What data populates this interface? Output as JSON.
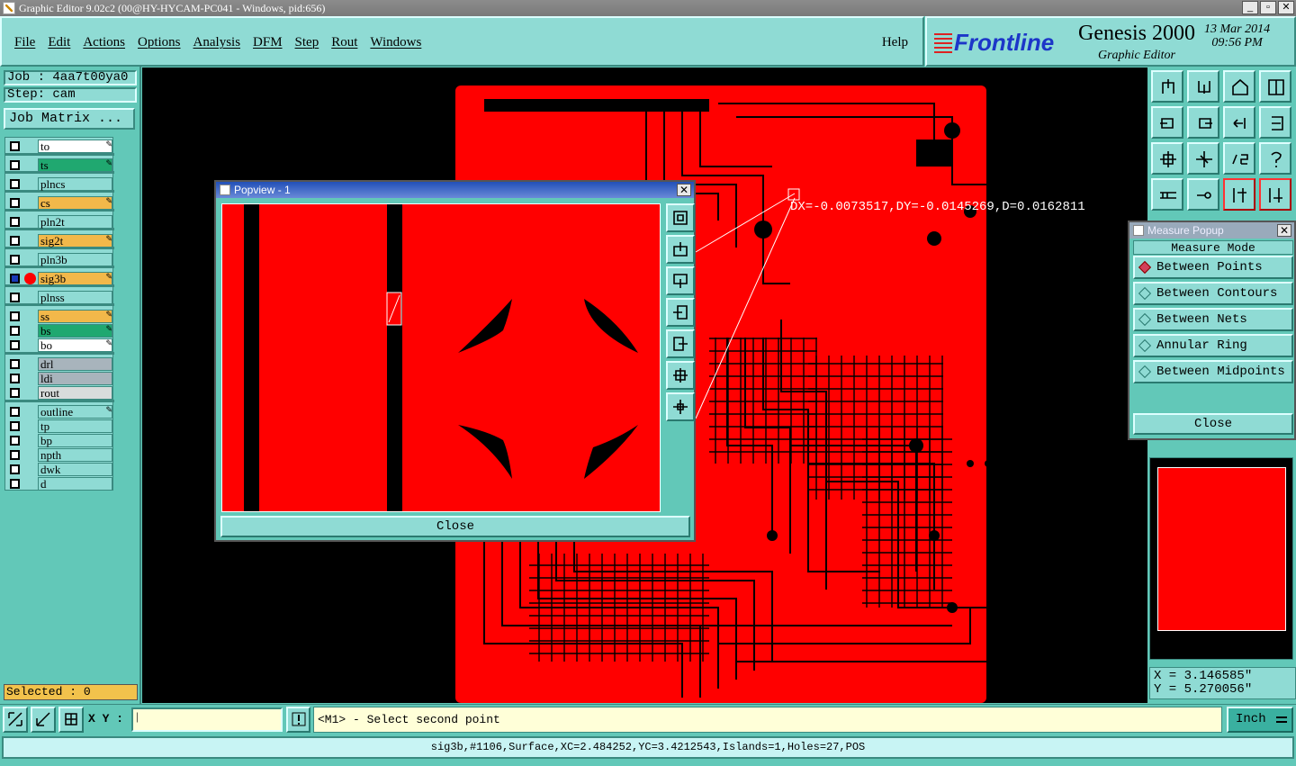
{
  "window": {
    "title": "Graphic Editor 9.02c2 (00@HY-HYCAM-PC041 - Windows, pid:656)"
  },
  "menu": [
    "File",
    "Edit",
    "Actions",
    "Options",
    "Analysis",
    "DFM",
    "Step",
    "Rout",
    "Windows"
  ],
  "help": "Help",
  "brand": {
    "logo": "Frontline",
    "product": "Genesis 2000",
    "subtitle": "Graphic Editor",
    "date": "13 Mar 2014",
    "time": "09:56 PM"
  },
  "job": {
    "job_label": "Job : 4aa7t00ya0",
    "step_label": "Step: cam",
    "matrix_button": "Job Matrix ..."
  },
  "layers": [
    {
      "name": "to",
      "color": "#ffffff",
      "mark": true
    },
    {
      "name": "ts",
      "color": "#20a870",
      "mark": true
    },
    {
      "name": "plncs",
      "color": "#8fdbd4",
      "mark": false
    },
    {
      "name": "cs",
      "color": "#f2b84a",
      "mark": true
    },
    {
      "name": "pln2t",
      "color": "#8fdbd4",
      "mark": false
    },
    {
      "name": "sig2t",
      "color": "#f2b84a",
      "mark": true
    },
    {
      "name": "pln3b",
      "color": "#8fdbd4",
      "mark": false
    },
    {
      "name": "sig3b",
      "color": "#f2b84a",
      "mark": true,
      "active": true
    },
    {
      "name": "plnss",
      "color": "#8fdbd4",
      "mark": false
    },
    {
      "name": "ss",
      "color": "#f2b84a",
      "mark": true
    },
    {
      "name": "bs",
      "color": "#20a870",
      "mark": true
    },
    {
      "name": "bo",
      "color": "#ffffff",
      "mark": true
    },
    {
      "name": "drl",
      "color": "#a8b4bc",
      "mark": false
    },
    {
      "name": "ldi",
      "color": "#a8b4bc",
      "mark": false
    },
    {
      "name": "rout",
      "color": "#d8dcdc",
      "mark": false
    },
    {
      "name": "outline",
      "color": "#8fdbd4",
      "mark": true
    },
    {
      "name": "tp",
      "color": "#8fdbd4",
      "mark": false
    },
    {
      "name": "bp",
      "color": "#8fdbd4",
      "mark": false
    },
    {
      "name": "npth",
      "color": "#8fdbd4",
      "mark": false
    },
    {
      "name": "dwk",
      "color": "#8fdbd4",
      "mark": false
    },
    {
      "name": "d",
      "color": "#8fdbd4",
      "mark": false
    }
  ],
  "selected": "Selected : 0",
  "measurement_readout": "DX=-0.0073517,DY=-0.0145269,D=0.0162811",
  "popview": {
    "title": "Popview - 1",
    "close": "Close"
  },
  "measure_popup": {
    "title": "Measure Popup",
    "mode_label": "Measure Mode",
    "options": [
      "Between Points",
      "Between Contours",
      "Between Nets",
      "Annular Ring",
      "Between Midpoints"
    ],
    "selected_index": 0,
    "close": "Close"
  },
  "coords": {
    "x": "X = 3.146585\"",
    "y": "Y = 5.270056\""
  },
  "command": {
    "xy_label": "X Y :",
    "xy_value": "",
    "message": "<M1> - Select second point",
    "units": "Inch"
  },
  "status": "sig3b,#1106,Surface,XC=2.484252,YC=3.4212543,Islands=1,Holes=27,POS",
  "colors": {
    "board": "#ff0000",
    "panel": "#62c8b8",
    "button": "#8fdbd4"
  }
}
